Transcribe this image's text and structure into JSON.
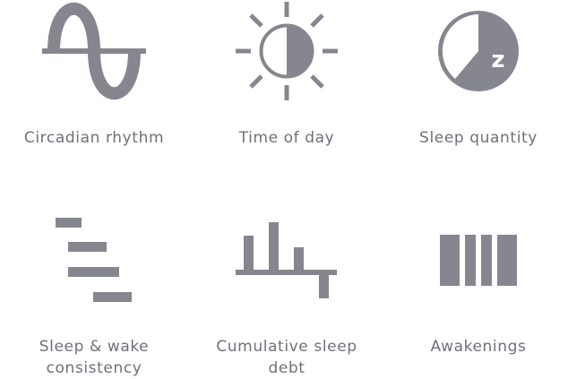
{
  "icon_color": "#86868f",
  "text_color": "#707078",
  "tiles": [
    {
      "icon": "circadian-rhythm-icon",
      "label": [
        "Circadian rhythm"
      ]
    },
    {
      "icon": "time-of-day-icon",
      "label": [
        "Time of day"
      ]
    },
    {
      "icon": "sleep-quantity-icon",
      "label": [
        "Sleep quantity"
      ]
    },
    {
      "icon": "sleep-wake-consistency-icon",
      "label": [
        "Sleep & wake",
        "consistency"
      ]
    },
    {
      "icon": "cumulative-sleep-debt-icon",
      "label": [
        "Cumulative sleep",
        "debt"
      ]
    },
    {
      "icon": "awakenings-icon",
      "label": [
        "Awakenings"
      ]
    }
  ]
}
